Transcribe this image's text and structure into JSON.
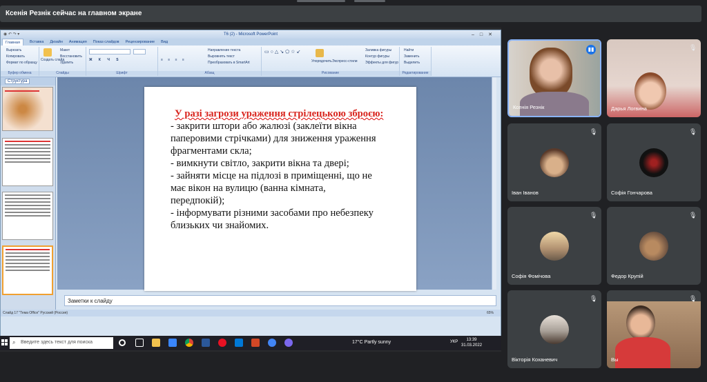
{
  "banner": {
    "text": "Ксенія Резнік сейчас на главном экране"
  },
  "powerpoint": {
    "window_title": "Т6 (2) - Microsoft PowerPoint",
    "ribbon_tabs": [
      "Главная",
      "Вставка",
      "Дизайн",
      "Анимация",
      "Показ слайдов",
      "Рецензирование",
      "Вид"
    ],
    "ribbon_groups": [
      "Буфер обмена",
      "Слайды",
      "Шрифт",
      "Абзац",
      "Рисование",
      "Редактирование"
    ],
    "ribbon_items": {
      "cut": "Вырезать",
      "copy": "Копировать",
      "format_painter": "Формат по образцу",
      "create_slide": "Создать слайд",
      "layout": "Макет",
      "reset": "Восстановить",
      "delete": "Удалить",
      "text_direction": "Направление текста",
      "align_text": "Выровнять текст",
      "smartart": "Преобразовать в SmartArt",
      "arrange": "Упорядочить",
      "quick_styles": "Экспресс-стили",
      "shape_fill": "Заливка фигуры",
      "shape_outline": "Контур фигуры",
      "shape_effects": "Эффекты для фигур",
      "find": "Найти",
      "replace": "Заменить",
      "select": "Выделить"
    },
    "sidepane_tab": "Структура",
    "slide": {
      "heading": "У разі загрози ураження стрілецькою зброєю:",
      "lines": [
        "- закрити штори або жалюзі (заклеїти вікна",
        "паперовими стрічками) для зниження ураження",
        "фрагментами скла;",
        "- вимкнути світло, закрити вікна та двері;",
        "- зайняти місце на підлозі в приміщенні, що не",
        "має вікон на вулицю (ванна кімната,",
        "передпокій);",
        "- інформувати різними засобами про небезпеку",
        "близьких чи знайомих."
      ]
    },
    "notes_placeholder": "Заметки к слайду",
    "status_left": "Слайд 17     \"Тема Office\"     Русский (Россия)",
    "zoom": "65%"
  },
  "taskbar": {
    "search_placeholder": "Введите здесь текст для поиска",
    "weather": "17°C  Partly sunny",
    "lang": "УКР",
    "time": "13:39",
    "date": "31.03.2022"
  },
  "participants": [
    {
      "name": "Ксенія Резнік",
      "speaking": true
    },
    {
      "name": "Дарья Логвина",
      "speaking": false
    },
    {
      "name": "Іван Іванов",
      "speaking": false
    },
    {
      "name": "Софія Гончарова",
      "speaking": false
    },
    {
      "name": "Софія Фомічова",
      "speaking": false
    },
    {
      "name": "Федор Крупій",
      "speaking": false
    },
    {
      "name": "Вікторія Коханевич",
      "speaking": false
    },
    {
      "name": "Вы",
      "speaking": false
    }
  ],
  "colors": {
    "meet_bg": "#202124",
    "tile_bg": "#3c4043",
    "speaking_accent": "#8ab4f8",
    "slide_heading": "#d8231c"
  }
}
